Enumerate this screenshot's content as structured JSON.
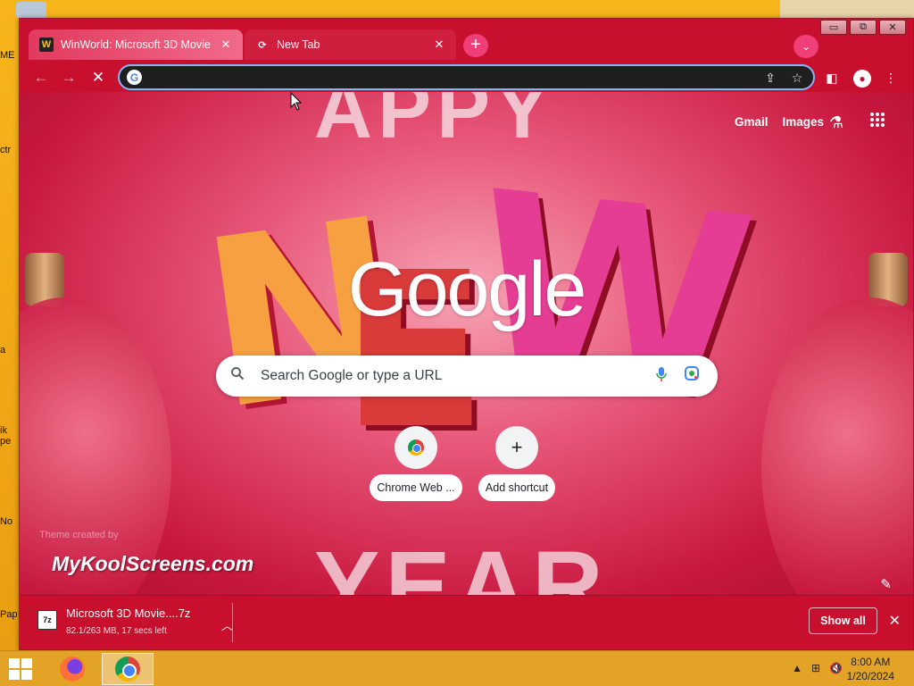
{
  "window": {
    "caption": {
      "minimize": "▭",
      "restore": "⧉",
      "close": "✕"
    }
  },
  "tabs": [
    {
      "title": "WinWorld: Microsoft 3D Movie M",
      "favicon": "W",
      "close": "✕"
    },
    {
      "title": "New Tab",
      "favicon": "⟳",
      "close": "✕"
    }
  ],
  "new_tab_symbol": "+",
  "tab_search_symbol": "⌄",
  "toolbar": {
    "back": "←",
    "forward": "→",
    "stop": "✕",
    "omnibox_value": "",
    "omnibox_g": "G",
    "share": "⇪",
    "star": "☆",
    "sidepanel": "◧",
    "menu": "⋮",
    "profile": "●"
  },
  "ntp": {
    "links": [
      "Gmail",
      "Images"
    ],
    "labs_icon": "⚗",
    "apps_icon": "⋮⋮⋮",
    "logo": "Google",
    "background_letters": {
      "top": "APPY",
      "main": [
        "N",
        "E",
        "W"
      ],
      "bottom": "YEAR"
    },
    "search": {
      "placeholder": "Search Google or type a URL",
      "search_icon": "🔍",
      "mic_icon": "🎤",
      "lens_icon": "◉"
    },
    "shortcuts": [
      {
        "label": "Chrome Web ..."
      },
      {
        "label": "Add shortcut",
        "tile": "+"
      }
    ],
    "theme_credit": "Theme created by",
    "watermark": "MyKoolScreens.com",
    "customize_icon": "✎"
  },
  "downloads": {
    "file_name": "Microsoft 3D Movie....7z",
    "status": "82.1/263 MB, 17 secs left",
    "progress_fraction": 0.312,
    "icon_text": "7z",
    "chevron": "︿",
    "show_all": "Show all",
    "close": "✕"
  },
  "taskbar": {
    "time": "8:00 AM",
    "date": "1/20/2024",
    "tray_icons": [
      "▲",
      "⊞",
      "🔇"
    ]
  },
  "desktop": {
    "icon_labels": [
      "ME",
      "ctr",
      "a",
      "ik pe",
      "No",
      "Pap"
    ]
  },
  "colors": {
    "accent": "#c8102e",
    "tab_active": "#e23a5e",
    "omnibox_focus": "#8ab4f8",
    "taskbar": "#e2a327"
  }
}
